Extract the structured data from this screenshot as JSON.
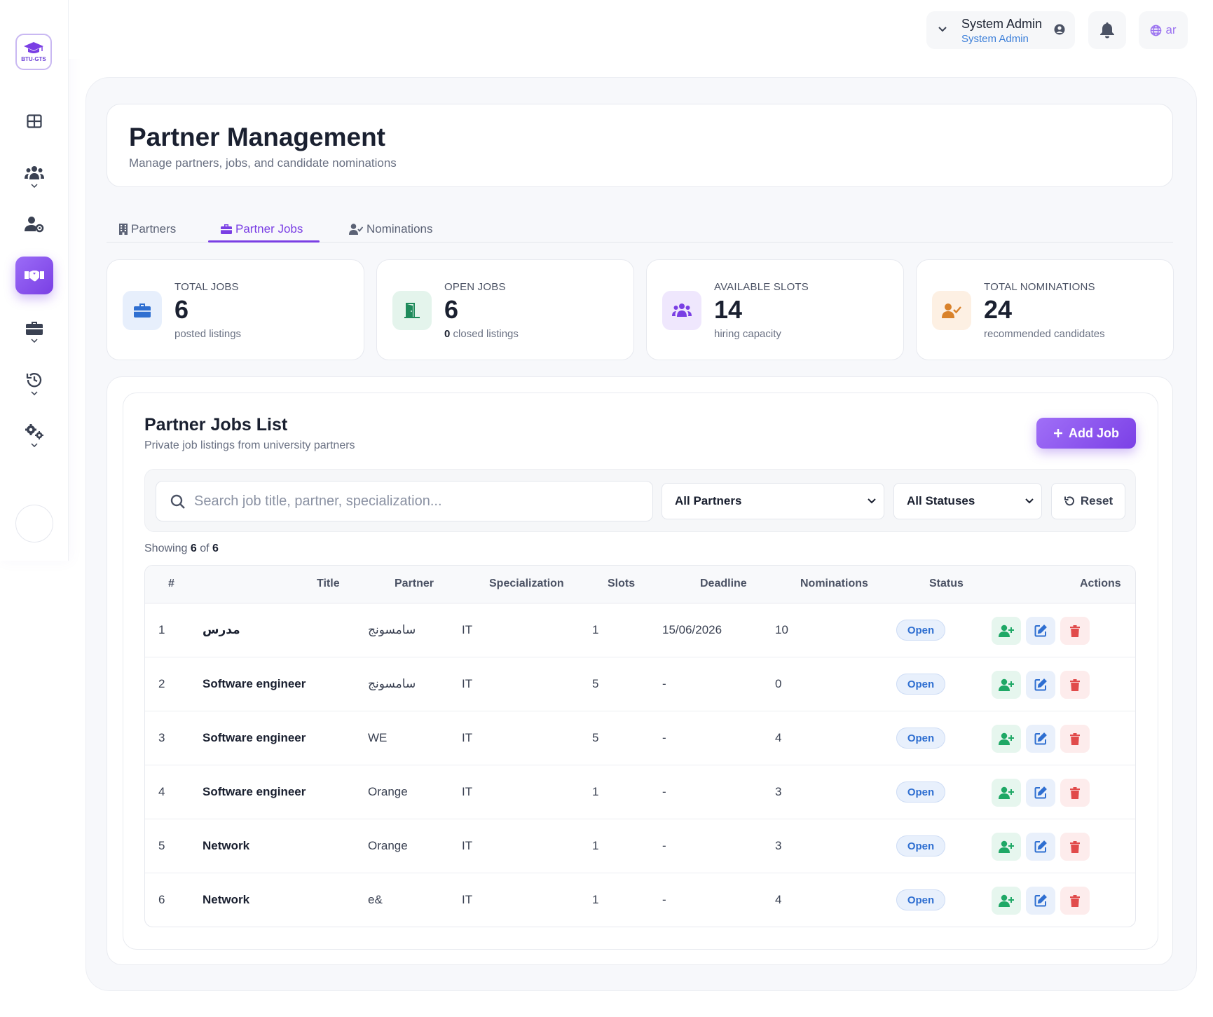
{
  "sidebar": {
    "logo_text": "BTU-GTS",
    "items": [
      {
        "icon": "dashboard-grid-icon"
      },
      {
        "icon": "users-group-icon"
      },
      {
        "icon": "user-cog-icon"
      },
      {
        "icon": "handshake-icon",
        "active": true
      },
      {
        "icon": "briefcase-icon"
      },
      {
        "icon": "history-icon"
      },
      {
        "icon": "settings-cogs-icon"
      }
    ]
  },
  "topbar": {
    "user_name": "System Admin",
    "user_role": "System Admin",
    "language": "ar"
  },
  "header": {
    "title": "Partner Management",
    "subtitle": "Manage partners, jobs, and candidate nominations"
  },
  "tabs": [
    {
      "label": "Partners",
      "icon": "building-icon"
    },
    {
      "label": "Partner Jobs",
      "icon": "briefcase-icon",
      "active": true
    },
    {
      "label": "Nominations",
      "icon": "user-check-icon"
    }
  ],
  "stats": [
    {
      "label": "TOTAL JOBS",
      "value": "6",
      "desc": "posted listings",
      "color": "#2f6fd1"
    },
    {
      "label": "OPEN JOBS",
      "value": "6",
      "desc_num": "0",
      "desc": "closed listings",
      "color": "#1f8a5b"
    },
    {
      "label": "AVAILABLE SLOTS",
      "value": "14",
      "desc": "hiring capacity",
      "color": "#7a3fe4"
    },
    {
      "label": "TOTAL NOMINATIONS",
      "value": "24",
      "desc": "recommended candidates",
      "color": "#d9822b"
    }
  ],
  "list": {
    "title": "Partner Jobs List",
    "subtitle": "Private job listings from university partners",
    "add_label": "Add Job",
    "search_placeholder": "Search job title, partner, specialization...",
    "partner_filter": "All Partners",
    "status_filter": "All Statuses",
    "reset_label": "Reset",
    "showing_prefix": "Showing",
    "showing_count": "6",
    "showing_of": "of",
    "showing_total": "6"
  },
  "table": {
    "headers": [
      "#",
      "Title",
      "Partner",
      "Specialization",
      "Slots",
      "Deadline",
      "Nominations",
      "Status",
      "Actions"
    ],
    "rows": [
      {
        "num": "1",
        "title": "مدرس",
        "partner": "سامسونج",
        "spec": "IT",
        "slots": "1",
        "deadline": "15/06/2026",
        "noms": "10",
        "status": "Open"
      },
      {
        "num": "2",
        "title": "Software engineer",
        "partner": "سامسونج",
        "spec": "IT",
        "slots": "5",
        "deadline": "-",
        "noms": "0",
        "status": "Open"
      },
      {
        "num": "3",
        "title": "Software engineer",
        "partner": "WE",
        "spec": "IT",
        "slots": "5",
        "deadline": "-",
        "noms": "4",
        "status": "Open"
      },
      {
        "num": "4",
        "title": "Software engineer",
        "partner": "Orange",
        "spec": "IT",
        "slots": "1",
        "deadline": "-",
        "noms": "3",
        "status": "Open"
      },
      {
        "num": "5",
        "title": "Network",
        "partner": "Orange",
        "spec": "IT",
        "slots": "1",
        "deadline": "-",
        "noms": "3",
        "status": "Open"
      },
      {
        "num": "6",
        "title": "Network",
        "partner": "e&",
        "spec": "IT",
        "slots": "1",
        "deadline": "-",
        "noms": "4",
        "status": "Open"
      }
    ]
  },
  "colors": {
    "accent": "#7a3fe4",
    "status_open": "#2f6fd1",
    "nominate_action": "#1fa866",
    "edit_action": "#2f6fd1",
    "delete_action": "#e14b4b"
  }
}
